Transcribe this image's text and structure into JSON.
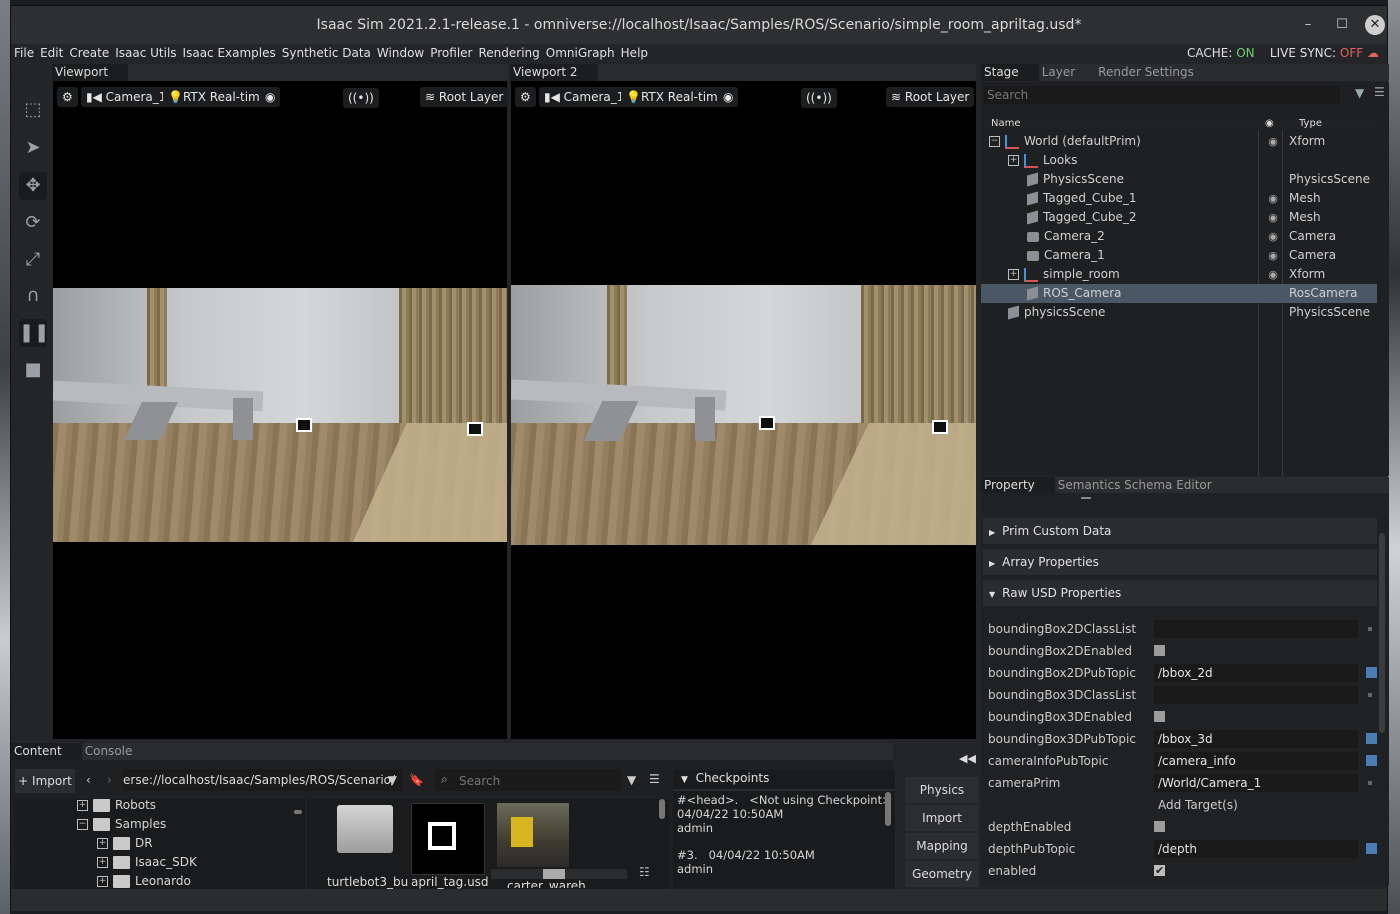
{
  "app": {
    "title": "Isaac Sim 2021.2.1-release.1 - omniverse://localhost/Isaac/Samples/ROS/Scenario/simple_room_apriltag.usd*",
    "menu": [
      "File",
      "Edit",
      "Create",
      "Isaac Utils",
      "Isaac Examples",
      "Synthetic Data",
      "Window",
      "Profiler",
      "Rendering",
      "OmniGraph",
      "Help"
    ],
    "cache_label": "CACHE:",
    "cache_value": "ON",
    "sync_label": "LIVE SYNC:",
    "sync_value": "OFF",
    "window_buttons": {
      "minimize": "–",
      "maximize": "☐",
      "close": "✕"
    }
  },
  "viewports": [
    {
      "tab": "Viewport",
      "camera": "Camera_1",
      "renderer": "RTX Real-time",
      "layer": "Root Layer"
    },
    {
      "tab": "Viewport 2",
      "camera": "Camera_1",
      "renderer": "RTX Real-time",
      "layer": "Root Layer"
    }
  ],
  "stage": {
    "tabs": [
      "Stage",
      "Layer",
      "Render Settings"
    ],
    "search_placeholder": "Search",
    "col_name": "Name",
    "col_type": "Type",
    "rows": [
      {
        "name": "World (defaultPrim)",
        "type": "Xform",
        "indent": 0,
        "icon": "xform",
        "expander": "−",
        "eye": true,
        "selected": false
      },
      {
        "name": "Looks",
        "type": "",
        "indent": 1,
        "icon": "xform",
        "expander": "+",
        "eye": false,
        "selected": false
      },
      {
        "name": "PhysicsScene",
        "type": "PhysicsScene",
        "indent": 2,
        "icon": "cube",
        "expander": "",
        "eye": false,
        "selected": false
      },
      {
        "name": "Tagged_Cube_1",
        "type": "Mesh",
        "indent": 2,
        "icon": "cube",
        "expander": "",
        "eye": true,
        "selected": false
      },
      {
        "name": "Tagged_Cube_2",
        "type": "Mesh",
        "indent": 2,
        "icon": "cube",
        "expander": "",
        "eye": true,
        "selected": false
      },
      {
        "name": "Camera_2",
        "type": "Camera",
        "indent": 2,
        "icon": "camera",
        "expander": "",
        "eye": true,
        "selected": false
      },
      {
        "name": "Camera_1",
        "type": "Camera",
        "indent": 2,
        "icon": "camera",
        "expander": "",
        "eye": true,
        "selected": false
      },
      {
        "name": "simple_room",
        "type": "Xform",
        "indent": 1,
        "icon": "xform",
        "expander": "+",
        "eye": true,
        "selected": false
      },
      {
        "name": "ROS_Camera",
        "type": "RosCamera",
        "indent": 2,
        "icon": "cube",
        "expander": "",
        "eye": false,
        "selected": true
      },
      {
        "name": "physicsScene",
        "type": "PhysicsScene",
        "indent": 1,
        "icon": "cube",
        "expander": "",
        "eye": false,
        "selected": false
      }
    ]
  },
  "property": {
    "tabs": [
      "Property",
      "Semantics Schema Editor"
    ],
    "sections": [
      "Prim Custom Data",
      "Array Properties",
      "Raw USD Properties"
    ],
    "rows": [
      {
        "label": "boundingBox2DClassList",
        "kind": "field",
        "value": "",
        "mark": false
      },
      {
        "label": "boundingBox2DEnabled",
        "kind": "check",
        "checked": false,
        "mark": false
      },
      {
        "label": "boundingBox2DPubTopic",
        "kind": "field",
        "value": "/bbox_2d",
        "mark": true
      },
      {
        "label": "boundingBox3DClassList",
        "kind": "field",
        "value": "",
        "mark": false
      },
      {
        "label": "boundingBox3DEnabled",
        "kind": "check",
        "checked": false,
        "mark": false
      },
      {
        "label": "boundingBox3DPubTopic",
        "kind": "field",
        "value": "/bbox_3d",
        "mark": true
      },
      {
        "label": "cameraInfoPubTopic",
        "kind": "field",
        "value": "/camera_info",
        "mark": true
      },
      {
        "label": "cameraPrim",
        "kind": "field",
        "value": "/World/Camera_1",
        "mark": false,
        "extra": "Add Target(s)"
      },
      {
        "label": "depthEnabled",
        "kind": "check",
        "checked": false,
        "mark": false
      },
      {
        "label": "depthPubTopic",
        "kind": "field",
        "value": "/depth",
        "mark": true
      },
      {
        "label": "enabled",
        "kind": "check",
        "checked": true,
        "mark": false
      }
    ]
  },
  "content": {
    "tabs": [
      "Content",
      "Console"
    ],
    "import_label": "Import",
    "path": "erse://localhost/Isaac/Samples/ROS/Scenario/",
    "search_placeholder": "Search",
    "tree": [
      {
        "label": "Robots",
        "indent": 0
      },
      {
        "label": "Samples",
        "indent": 0
      },
      {
        "label": "DR",
        "indent": 1
      },
      {
        "label": "Isaac_SDK",
        "indent": 1
      },
      {
        "label": "Leonardo",
        "indent": 1
      }
    ],
    "thumbs": [
      "turtlebot3_bu",
      "april_tag.usd",
      "carter_wareh"
    ],
    "checkpoints_title": "Checkpoints",
    "checkpoints": [
      {
        "line1": "#<head>.   <Not using Checkpoint>",
        "line2": "04/04/22 10:50AM",
        "line3": "admin"
      },
      {
        "line1": "#3.   04/04/22 10:50AM",
        "line2": "admin",
        "line3": ""
      }
    ]
  },
  "extensions": [
    "Physics",
    "Import",
    "Mapping",
    "Geometry"
  ]
}
